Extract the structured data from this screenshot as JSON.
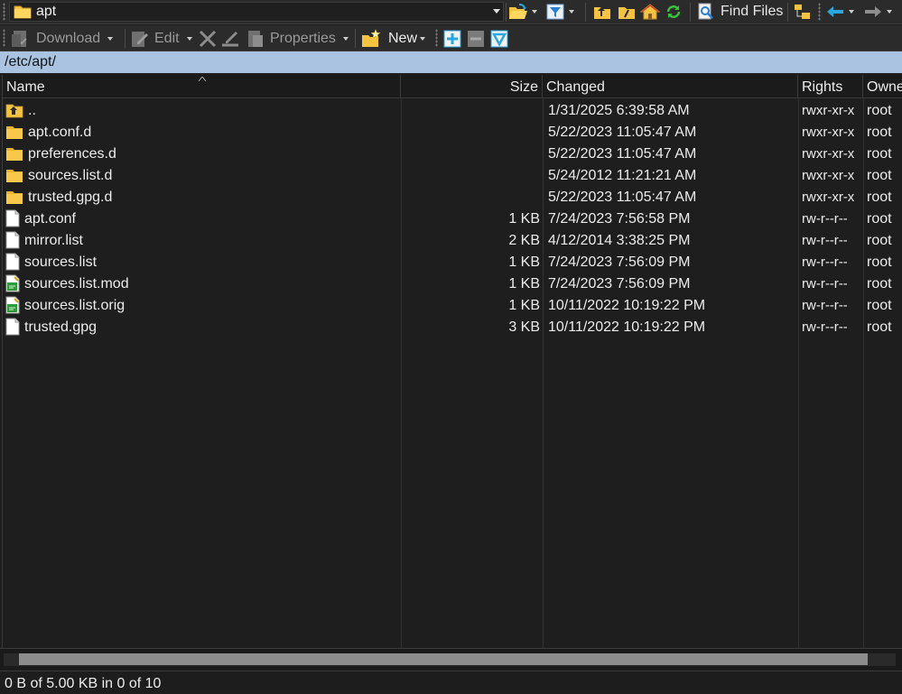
{
  "toolbar_top": {
    "path_label": "apt",
    "find_files_label": "Find Files"
  },
  "toolbar_actions": {
    "download_label": "Download",
    "edit_label": "Edit",
    "properties_label": "Properties",
    "new_label": "New"
  },
  "address": "/etc/apt/",
  "columns": {
    "name": "Name",
    "size": "Size",
    "changed": "Changed",
    "rights": "Rights",
    "owner": "Owne"
  },
  "files": [
    {
      "name": "..",
      "size": "",
      "changed": "1/31/2025 6:39:58 AM",
      "rights": "rwxr-xr-x",
      "owner": "root",
      "icon": "parent-folder-icon"
    },
    {
      "name": "apt.conf.d",
      "size": "",
      "changed": "5/22/2023 11:05:47 AM",
      "rights": "rwxr-xr-x",
      "owner": "root",
      "icon": "folder-icon"
    },
    {
      "name": "preferences.d",
      "size": "",
      "changed": "5/22/2023 11:05:47 AM",
      "rights": "rwxr-xr-x",
      "owner": "root",
      "icon": "folder-icon"
    },
    {
      "name": "sources.list.d",
      "size": "",
      "changed": "5/24/2012 11:21:21 AM",
      "rights": "rwxr-xr-x",
      "owner": "root",
      "icon": "folder-icon"
    },
    {
      "name": "trusted.gpg.d",
      "size": "",
      "changed": "5/22/2023 11:05:47 AM",
      "rights": "rwxr-xr-x",
      "owner": "root",
      "icon": "folder-icon"
    },
    {
      "name": "apt.conf",
      "size": "1 KB",
      "changed": "7/24/2023 7:56:58 PM",
      "rights": "rw-r--r--",
      "owner": "root",
      "icon": "file-icon"
    },
    {
      "name": "mirror.list",
      "size": "2 KB",
      "changed": "4/12/2014 3:38:25 PM",
      "rights": "rw-r--r--",
      "owner": "root",
      "icon": "file-icon"
    },
    {
      "name": "sources.list",
      "size": "1 KB",
      "changed": "7/24/2023 7:56:09 PM",
      "rights": "rw-r--r--",
      "owner": "root",
      "icon": "file-icon"
    },
    {
      "name": "sources.list.mod",
      "size": "1 KB",
      "changed": "7/24/2023 7:56:09 PM",
      "rights": "rw-r--r--",
      "owner": "root",
      "icon": "script-file-icon"
    },
    {
      "name": "sources.list.orig",
      "size": "1 KB",
      "changed": "10/11/2022 10:19:22 PM",
      "rights": "rw-r--r--",
      "owner": "root",
      "icon": "script-file-icon"
    },
    {
      "name": "trusted.gpg",
      "size": "3 KB",
      "changed": "10/11/2022 10:19:22 PM",
      "rights": "rw-r--r--",
      "owner": "root",
      "icon": "file-icon"
    }
  ],
  "status": "0 B of 5.00 KB in 0 of 10",
  "colors": {
    "address_bg": "#a9c3e0",
    "folder_yellow": "#f5c342",
    "accent_blue": "#2aa6e0",
    "accent_green": "#3cbf3c"
  }
}
